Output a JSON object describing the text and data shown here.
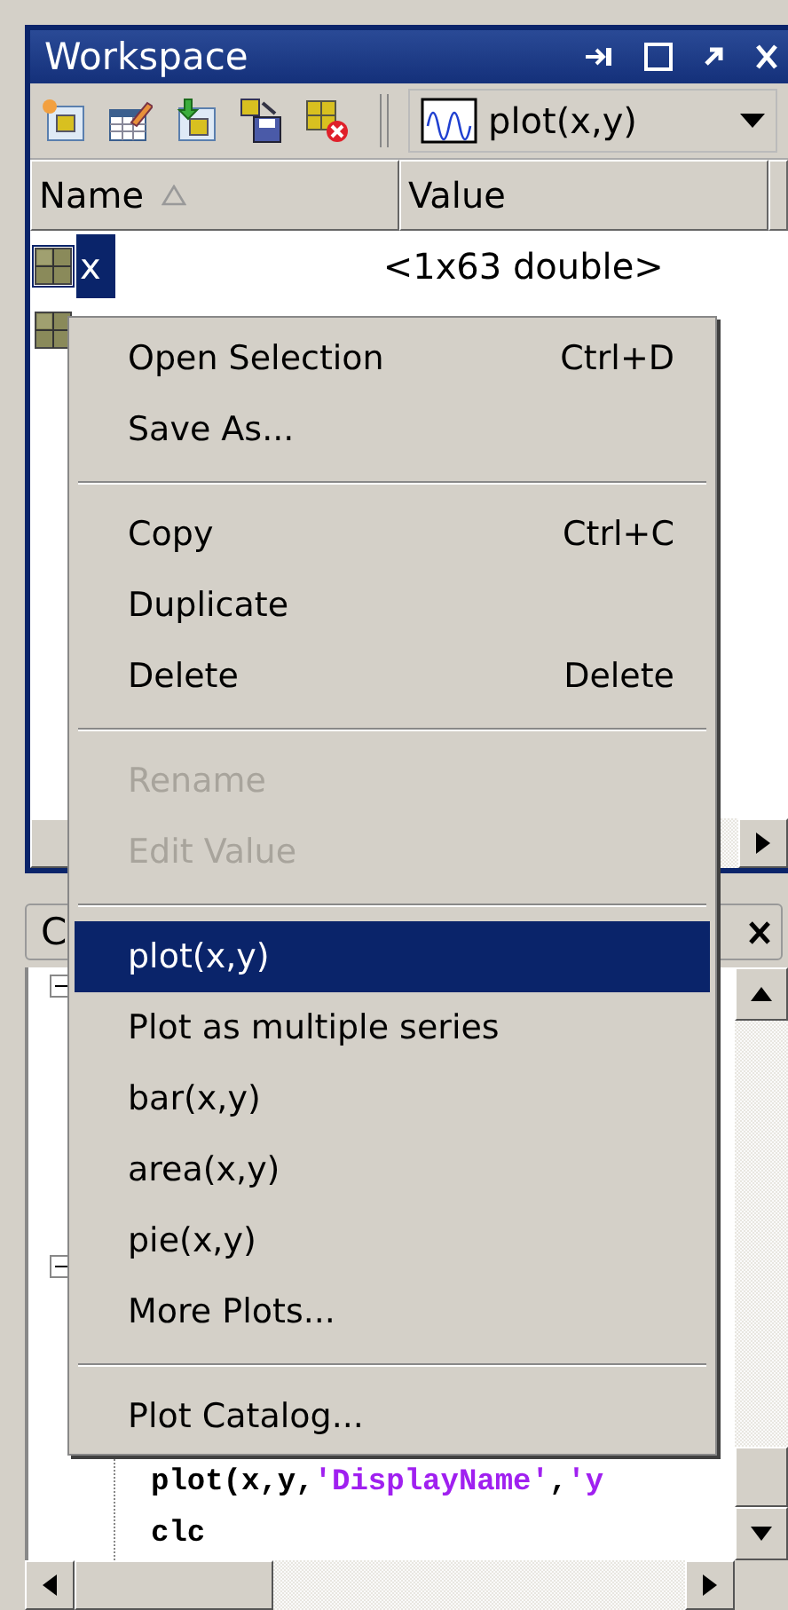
{
  "workspace": {
    "title": "Workspace",
    "plot_selector": {
      "label": "plot(x,y)"
    },
    "columns": [
      {
        "label": "Name",
        "sorted": true
      },
      {
        "label": "Value",
        "sorted": false
      }
    ],
    "rows": [
      {
        "name": "x",
        "value": "<1x63 double>",
        "selected": true
      },
      {
        "selected": false
      }
    ]
  },
  "command_history": {
    "title": "C",
    "lines": [
      {
        "segments": [
          {
            "kind": "code",
            "text": "plot(x,y,"
          },
          {
            "kind": "string",
            "text": "'DisplayName'"
          },
          {
            "kind": "code",
            "text": ","
          },
          {
            "kind": "string",
            "text": "'y"
          }
        ]
      },
      {
        "segments": [
          {
            "kind": "code",
            "text": "clc"
          }
        ]
      }
    ]
  },
  "context_menu": [
    {
      "kind": "item",
      "label": "Open Selection",
      "shortcut": "Ctrl+D",
      "disabled": false,
      "selected": false
    },
    {
      "kind": "item",
      "label": "Save As...",
      "disabled": false,
      "selected": false
    },
    {
      "kind": "separator"
    },
    {
      "kind": "item",
      "label": "Copy",
      "shortcut": "Ctrl+C",
      "disabled": false,
      "selected": false
    },
    {
      "kind": "item",
      "label": "Duplicate",
      "disabled": false,
      "selected": false
    },
    {
      "kind": "item",
      "label": "Delete",
      "shortcut": "Delete",
      "disabled": false,
      "selected": false
    },
    {
      "kind": "separator"
    },
    {
      "kind": "item",
      "label": "Rename",
      "disabled": true,
      "selected": false
    },
    {
      "kind": "item",
      "label": "Edit Value",
      "disabled": true,
      "selected": false
    },
    {
      "kind": "separator"
    },
    {
      "kind": "item",
      "label": "plot(x,y)",
      "disabled": false,
      "selected": true
    },
    {
      "kind": "item",
      "label": "Plot as multiple series",
      "disabled": false,
      "selected": false
    },
    {
      "kind": "item",
      "label": "bar(x,y)",
      "disabled": false,
      "selected": false
    },
    {
      "kind": "item",
      "label": "area(x,y)",
      "disabled": false,
      "selected": false
    },
    {
      "kind": "item",
      "label": "pie(x,y)",
      "disabled": false,
      "selected": false
    },
    {
      "kind": "item",
      "label": "More Plots...",
      "disabled": false,
      "selected": false
    },
    {
      "kind": "separator"
    },
    {
      "kind": "item",
      "label": "Plot Catalog...",
      "disabled": false,
      "selected": false
    }
  ]
}
